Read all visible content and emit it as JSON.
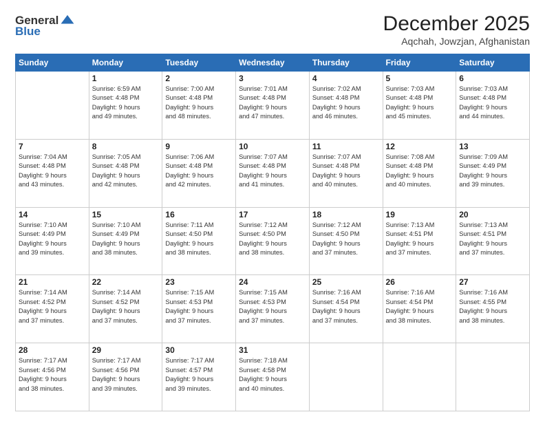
{
  "logo": {
    "general": "General",
    "blue": "Blue"
  },
  "title": "December 2025",
  "location": "Aqchah, Jowzjan, Afghanistan",
  "weekdays": [
    "Sunday",
    "Monday",
    "Tuesday",
    "Wednesday",
    "Thursday",
    "Friday",
    "Saturday"
  ],
  "weeks": [
    [
      {
        "day": "",
        "info": ""
      },
      {
        "day": "1",
        "info": "Sunrise: 6:59 AM\nSunset: 4:48 PM\nDaylight: 9 hours\nand 49 minutes."
      },
      {
        "day": "2",
        "info": "Sunrise: 7:00 AM\nSunset: 4:48 PM\nDaylight: 9 hours\nand 48 minutes."
      },
      {
        "day": "3",
        "info": "Sunrise: 7:01 AM\nSunset: 4:48 PM\nDaylight: 9 hours\nand 47 minutes."
      },
      {
        "day": "4",
        "info": "Sunrise: 7:02 AM\nSunset: 4:48 PM\nDaylight: 9 hours\nand 46 minutes."
      },
      {
        "day": "5",
        "info": "Sunrise: 7:03 AM\nSunset: 4:48 PM\nDaylight: 9 hours\nand 45 minutes."
      },
      {
        "day": "6",
        "info": "Sunrise: 7:03 AM\nSunset: 4:48 PM\nDaylight: 9 hours\nand 44 minutes."
      }
    ],
    [
      {
        "day": "7",
        "info": "Sunrise: 7:04 AM\nSunset: 4:48 PM\nDaylight: 9 hours\nand 43 minutes."
      },
      {
        "day": "8",
        "info": "Sunrise: 7:05 AM\nSunset: 4:48 PM\nDaylight: 9 hours\nand 42 minutes."
      },
      {
        "day": "9",
        "info": "Sunrise: 7:06 AM\nSunset: 4:48 PM\nDaylight: 9 hours\nand 42 minutes."
      },
      {
        "day": "10",
        "info": "Sunrise: 7:07 AM\nSunset: 4:48 PM\nDaylight: 9 hours\nand 41 minutes."
      },
      {
        "day": "11",
        "info": "Sunrise: 7:07 AM\nSunset: 4:48 PM\nDaylight: 9 hours\nand 40 minutes."
      },
      {
        "day": "12",
        "info": "Sunrise: 7:08 AM\nSunset: 4:48 PM\nDaylight: 9 hours\nand 40 minutes."
      },
      {
        "day": "13",
        "info": "Sunrise: 7:09 AM\nSunset: 4:49 PM\nDaylight: 9 hours\nand 39 minutes."
      }
    ],
    [
      {
        "day": "14",
        "info": "Sunrise: 7:10 AM\nSunset: 4:49 PM\nDaylight: 9 hours\nand 39 minutes."
      },
      {
        "day": "15",
        "info": "Sunrise: 7:10 AM\nSunset: 4:49 PM\nDaylight: 9 hours\nand 38 minutes."
      },
      {
        "day": "16",
        "info": "Sunrise: 7:11 AM\nSunset: 4:50 PM\nDaylight: 9 hours\nand 38 minutes."
      },
      {
        "day": "17",
        "info": "Sunrise: 7:12 AM\nSunset: 4:50 PM\nDaylight: 9 hours\nand 38 minutes."
      },
      {
        "day": "18",
        "info": "Sunrise: 7:12 AM\nSunset: 4:50 PM\nDaylight: 9 hours\nand 37 minutes."
      },
      {
        "day": "19",
        "info": "Sunrise: 7:13 AM\nSunset: 4:51 PM\nDaylight: 9 hours\nand 37 minutes."
      },
      {
        "day": "20",
        "info": "Sunrise: 7:13 AM\nSunset: 4:51 PM\nDaylight: 9 hours\nand 37 minutes."
      }
    ],
    [
      {
        "day": "21",
        "info": "Sunrise: 7:14 AM\nSunset: 4:52 PM\nDaylight: 9 hours\nand 37 minutes."
      },
      {
        "day": "22",
        "info": "Sunrise: 7:14 AM\nSunset: 4:52 PM\nDaylight: 9 hours\nand 37 minutes."
      },
      {
        "day": "23",
        "info": "Sunrise: 7:15 AM\nSunset: 4:53 PM\nDaylight: 9 hours\nand 37 minutes."
      },
      {
        "day": "24",
        "info": "Sunrise: 7:15 AM\nSunset: 4:53 PM\nDaylight: 9 hours\nand 37 minutes."
      },
      {
        "day": "25",
        "info": "Sunrise: 7:16 AM\nSunset: 4:54 PM\nDaylight: 9 hours\nand 37 minutes."
      },
      {
        "day": "26",
        "info": "Sunrise: 7:16 AM\nSunset: 4:54 PM\nDaylight: 9 hours\nand 38 minutes."
      },
      {
        "day": "27",
        "info": "Sunrise: 7:16 AM\nSunset: 4:55 PM\nDaylight: 9 hours\nand 38 minutes."
      }
    ],
    [
      {
        "day": "28",
        "info": "Sunrise: 7:17 AM\nSunset: 4:56 PM\nDaylight: 9 hours\nand 38 minutes."
      },
      {
        "day": "29",
        "info": "Sunrise: 7:17 AM\nSunset: 4:56 PM\nDaylight: 9 hours\nand 39 minutes."
      },
      {
        "day": "30",
        "info": "Sunrise: 7:17 AM\nSunset: 4:57 PM\nDaylight: 9 hours\nand 39 minutes."
      },
      {
        "day": "31",
        "info": "Sunrise: 7:18 AM\nSunset: 4:58 PM\nDaylight: 9 hours\nand 40 minutes."
      },
      {
        "day": "",
        "info": ""
      },
      {
        "day": "",
        "info": ""
      },
      {
        "day": "",
        "info": ""
      }
    ]
  ]
}
